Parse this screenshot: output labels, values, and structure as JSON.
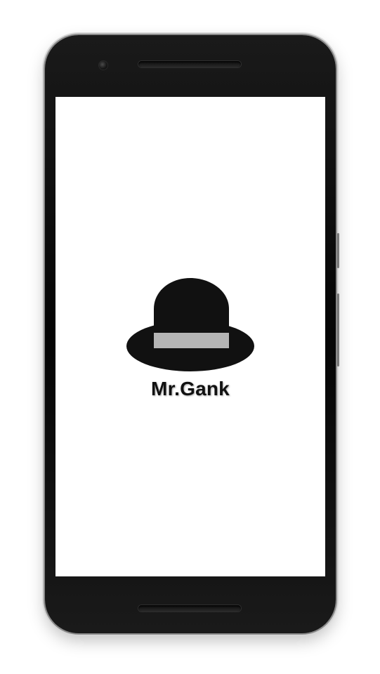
{
  "splash": {
    "brand_name": "Mr.Gank",
    "logo_icon": "bowler-hat-icon"
  },
  "colors": {
    "screen_background": "#ffffff",
    "hat_color": "#111111",
    "hat_band_color": "#b5b5b5",
    "text_color": "#111111",
    "device_frame": "#0a0a0a"
  }
}
